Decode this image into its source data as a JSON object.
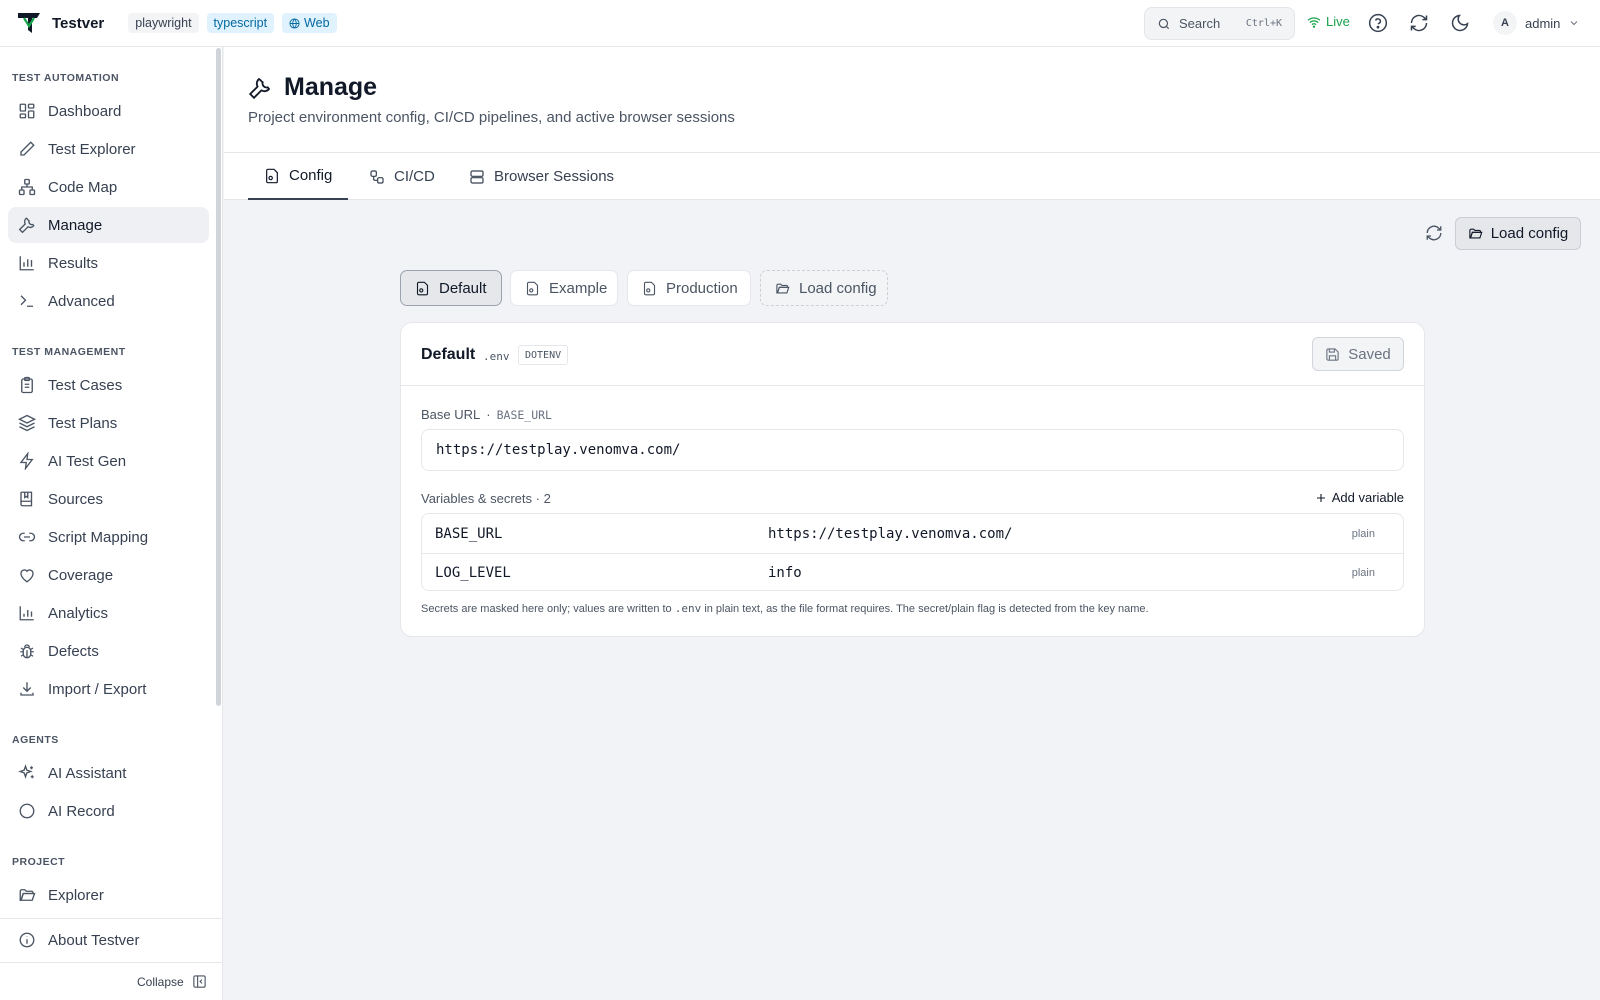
{
  "topbar": {
    "brand": "Testver",
    "chips": [
      "playwright",
      "typescript",
      "Web"
    ],
    "search_label": "Search",
    "search_shortcut": "Ctrl+K",
    "live_label": "Live",
    "user_initial": "A",
    "user_name": "admin"
  },
  "sidebar": {
    "sections": {
      "automation": "TEST AUTOMATION",
      "management": "TEST MANAGEMENT",
      "agents": "AGENTS",
      "project": "PROJECT"
    },
    "items": {
      "dashboard": "Dashboard",
      "test_explorer": "Test Explorer",
      "code_map": "Code Map",
      "manage": "Manage",
      "results": "Results",
      "advanced": "Advanced",
      "test_cases": "Test Cases",
      "test_plans": "Test Plans",
      "ai_test_gen": "AI Test Gen",
      "sources": "Sources",
      "script_mapping": "Script Mapping",
      "coverage": "Coverage",
      "analytics": "Analytics",
      "defects": "Defects",
      "import_export": "Import / Export",
      "ai_assistant": "AI Assistant",
      "ai_record": "AI Record",
      "explorer": "Explorer",
      "about": "About Testver"
    },
    "active": "Manage",
    "collapse_label": "Collapse"
  },
  "page": {
    "title": "Manage",
    "subtitle": "Project environment config, CI/CD pipelines, and active browser sessions",
    "tabs": [
      "Config",
      "CI/CD",
      "Browser Sessions"
    ],
    "active_tab": "Config",
    "load_config_label": "Load config"
  },
  "config": {
    "profiles": [
      "Default",
      "Example",
      "Production"
    ],
    "active_profile": "Default",
    "load_config_label": "Load config",
    "card": {
      "name": "Default",
      "file": ".env",
      "format": "DOTENV",
      "saved_label": "Saved",
      "base_url_label": "Base URL",
      "base_url_sep": "·",
      "base_url_key": "BASE_URL",
      "base_url_value": "https://testplay.venomva.com/",
      "variables_label": "Variables & secrets · 2",
      "add_variable_label": "Add variable",
      "variables": [
        {
          "key": "BASE_URL",
          "value": "https://testplay.venomva.com/",
          "type": "plain"
        },
        {
          "key": "LOG_LEVEL",
          "value": "info",
          "type": "plain"
        }
      ],
      "note_before": "Secrets are masked here only; values are written to",
      "note_file": ".env",
      "note_after": "in plain text, as the file format requires. The secret/plain flag is detected from the key name."
    }
  },
  "colors": {
    "live": "#16a34a",
    "chip_blue_bg": "#e0f2fe",
    "chip_blue_fg": "#0369a1"
  }
}
